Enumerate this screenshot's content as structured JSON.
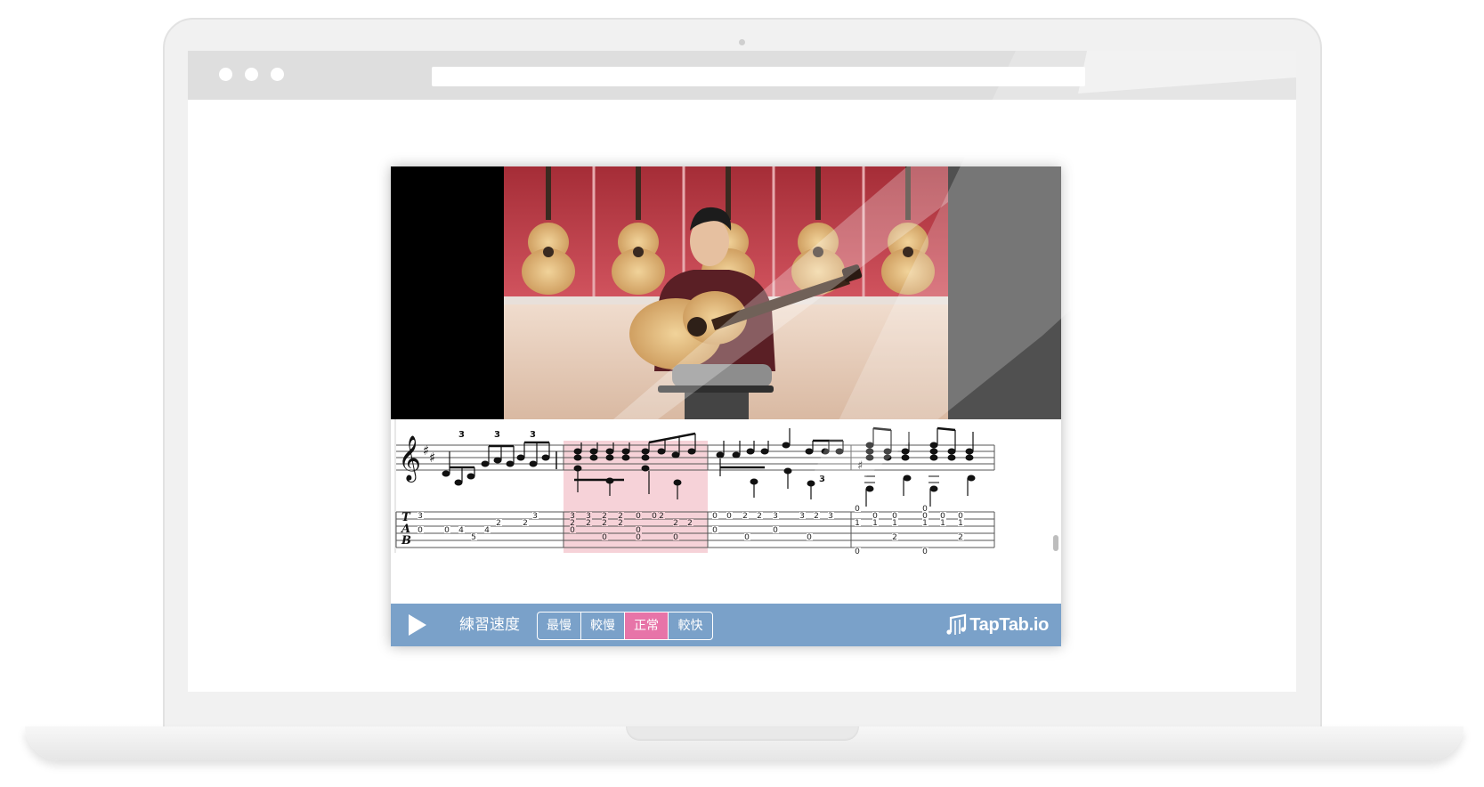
{
  "controls": {
    "speed_label": "練習速度",
    "speed_options": [
      "最慢",
      "較慢",
      "正常",
      "較快"
    ],
    "active_speed": "正常",
    "brand": "TapTab.io"
  },
  "score": {
    "triplet_marks": [
      "3",
      "3",
      "3",
      "3"
    ],
    "tab_clef": [
      "T",
      "A",
      "B"
    ],
    "tab_numbers": [
      "3",
      "3",
      "0",
      "0",
      "4",
      "4",
      "5",
      "2",
      "2",
      "3",
      "3",
      "2",
      "2",
      "0",
      "0",
      "2",
      "2",
      "2",
      "2",
      "2",
      "2",
      "0",
      "0",
      "0",
      "0",
      "0",
      "2",
      "2",
      "0",
      "0",
      "2",
      "2",
      "3",
      "3",
      "2",
      "3",
      "0",
      "0",
      "0",
      "0",
      "0",
      "0",
      "0",
      "0",
      "0",
      "0",
      "0",
      "1",
      "1",
      "1",
      "1",
      "1",
      "1",
      "2",
      "2",
      "0",
      "0"
    ],
    "highlight_color": "#f6d2d8"
  },
  "colors": {
    "control_bar": "#7aa1c9",
    "active_button": "#e774a8",
    "video_wall": "#c9414b"
  }
}
